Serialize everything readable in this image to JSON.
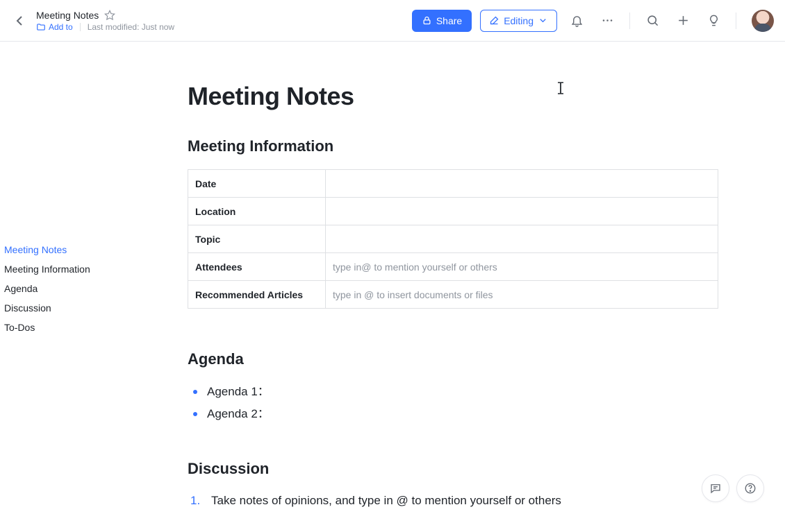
{
  "header": {
    "doc_title": "Meeting Notes",
    "add_to_label": "Add to",
    "last_modified": "Last modified: Just now",
    "share_label": "Share",
    "editing_label": "Editing"
  },
  "outline": {
    "items": [
      {
        "label": "Meeting Notes",
        "active": true
      },
      {
        "label": "Meeting Information",
        "active": false
      },
      {
        "label": "Agenda",
        "active": false
      },
      {
        "label": "Discussion",
        "active": false
      },
      {
        "label": "To-Dos",
        "active": false
      }
    ]
  },
  "document": {
    "title": "Meeting Notes",
    "info_heading": "Meeting Information",
    "info_rows": [
      {
        "label": "Date",
        "value": ""
      },
      {
        "label": "Location",
        "value": ""
      },
      {
        "label": "Topic",
        "value": ""
      },
      {
        "label": "Attendees",
        "value": "type in@ to mention yourself or others"
      },
      {
        "label": "Recommended Articles",
        "value": "type in @ to insert documents or files"
      }
    ],
    "agenda_heading": "Agenda",
    "agenda_items": [
      "Agenda 1：",
      "Agenda 2："
    ],
    "discussion_heading": "Discussion",
    "discussion_items": [
      "Take notes of opinions, and type in @ to mention yourself or others"
    ]
  }
}
